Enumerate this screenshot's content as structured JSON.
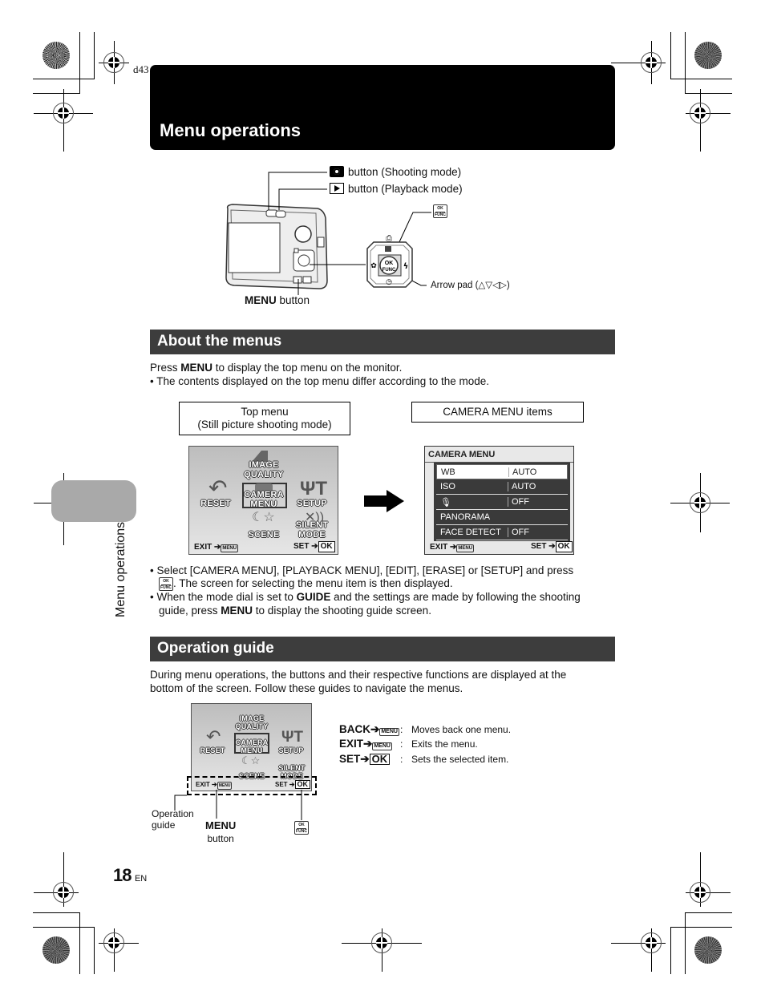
{
  "doc_code": "d43",
  "header": {
    "title": "Menu operations"
  },
  "diagram_camera": {
    "shooting_button_label": "button (Shooting mode)",
    "playback_button_label": "button (Playback mode)",
    "menu_button_key": "MENU",
    "menu_button_label": "button",
    "arrow_pad_label": "Arrow pad (△▽◁▷)",
    "okfunc_top": "OK",
    "okfunc_bottom": "FUNC",
    "icons": [
      "camera-icon",
      "playback-icon",
      "okfunc-icon"
    ]
  },
  "about_menus": {
    "title": "About the menus",
    "intro_prefix": "Press ",
    "intro_key": "MENU",
    "intro_suffix": " to display the top menu on the monitor.",
    "bullet1": "The contents displayed on the top menu differ according to the mode.",
    "label_top_menu_line1": "Top menu",
    "label_top_menu_line2": "(Still picture shooting mode)",
    "label_camera_menu": "CAMERA MENU items",
    "top_menu": {
      "items": {
        "image_quality": "IMAGE\nQUALITY",
        "reset": "RESET",
        "camera_menu": "CAMERA\nMENU",
        "setup": "SETUP",
        "scene": "SCENE",
        "silent_mode": "SILENT\nMODE"
      },
      "footer_left": "EXIT",
      "footer_right": "SET",
      "menu_key": "MENU",
      "ok_key": "OK"
    },
    "camera_menu": {
      "title": "CAMERA MENU",
      "rows": [
        {
          "key": "WB",
          "value": "AUTO",
          "selected": true
        },
        {
          "key": "ISO",
          "value": "AUTO",
          "selected": false
        },
        {
          "key": "🎙",
          "value": "OFF",
          "selected": false
        },
        {
          "key": "PANORAMA",
          "value": "",
          "selected": false
        },
        {
          "key": "FACE DETECT",
          "value": "OFF",
          "selected": false
        }
      ],
      "footer_left": "EXIT",
      "footer_right": "SET"
    },
    "bullet2_line1": "Select [CAMERA MENU], [PLAYBACK MENU], [EDIT], [ERASE] or [SETUP] and press",
    "bullet2_line2": ". The screen for selecting the menu item is then displayed.",
    "bullet3_prefix": "When the mode dial is set to ",
    "bullet3_key": "GUIDE",
    "bullet3_mid": " and the settings are made by following the shooting",
    "bullet3_line2_prefix": "guide, press ",
    "bullet3_line2_key": "MENU",
    "bullet3_line2_suffix": " to display the shooting guide screen."
  },
  "operation_guide": {
    "title": "Operation guide",
    "para_line1": "During menu operations, the buttons and their respective functions are displayed at the",
    "para_line2": "bottom of the screen. Follow these guides to navigate the menus.",
    "callout_operation": "Operation\nguide",
    "callout_menu_key": "MENU",
    "callout_menu_label": "button",
    "legend": [
      {
        "key": "BACK",
        "icon": "MENU",
        "desc": "Moves back one menu."
      },
      {
        "key": "EXIT",
        "icon": "MENU",
        "desc": "Exits the menu."
      },
      {
        "key": "SET",
        "icon": "OK",
        "desc": "Sets the selected item."
      }
    ]
  },
  "sidebar": {
    "tab_text": "Menu operations"
  },
  "footer": {
    "page_number": "18",
    "lang": "EN"
  }
}
